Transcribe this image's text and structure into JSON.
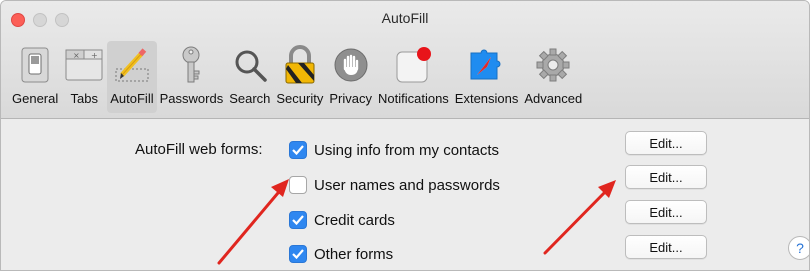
{
  "window": {
    "title": "AutoFill"
  },
  "toolbar": {
    "items": [
      {
        "label": "General",
        "icon": "switch-icon"
      },
      {
        "label": "Tabs",
        "icon": "tabs-icon"
      },
      {
        "label": "AutoFill",
        "icon": "pencil-form-icon",
        "selected": true
      },
      {
        "label": "Passwords",
        "icon": "key-icon"
      },
      {
        "label": "Search",
        "icon": "magnifier-icon"
      },
      {
        "label": "Security",
        "icon": "padlock-icon"
      },
      {
        "label": "Privacy",
        "icon": "hand-icon"
      },
      {
        "label": "Notifications",
        "icon": "notification-badge-icon"
      },
      {
        "label": "Extensions",
        "icon": "puzzle-compass-icon"
      },
      {
        "label": "Advanced",
        "icon": "gear-icon"
      }
    ]
  },
  "autofill": {
    "label": "AutoFill web forms:",
    "options": [
      {
        "label": "Using info from my contacts",
        "checked": true,
        "edit": "Edit..."
      },
      {
        "label": "User names and passwords",
        "checked": false,
        "edit": "Edit..."
      },
      {
        "label": "Credit cards",
        "checked": true,
        "edit": "Edit..."
      },
      {
        "label": "Other forms",
        "checked": true,
        "edit": "Edit..."
      }
    ]
  },
  "help": {
    "label": "?"
  },
  "colors": {
    "checkbox_on": "#2f87f0",
    "arrow": "#e0261f",
    "close_button": "#fc5f57"
  }
}
